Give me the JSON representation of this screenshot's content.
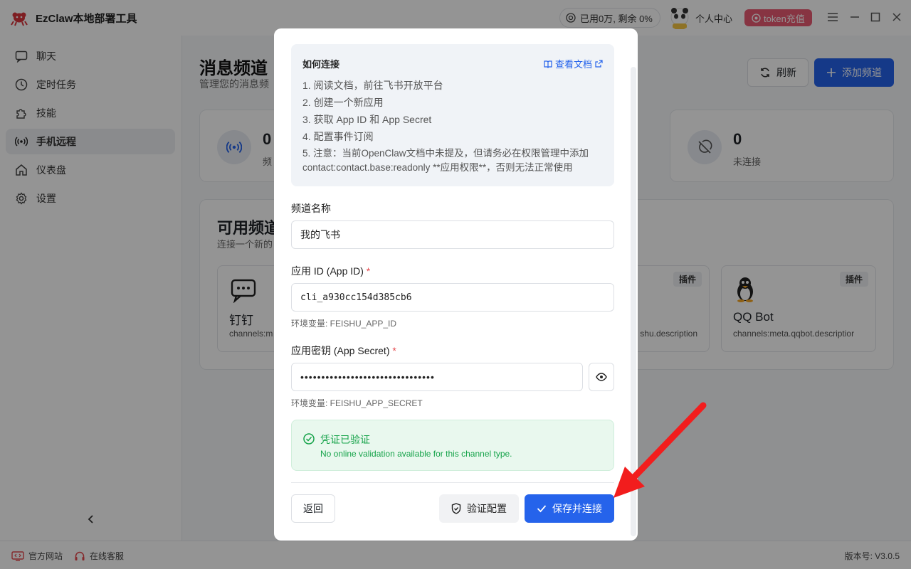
{
  "app": {
    "title": "EzClaw本地部署工具",
    "usage": "已用0万, 剩余 0%",
    "user_center": "个人中心",
    "token_button": "token充值"
  },
  "sidebar": {
    "items": [
      {
        "label": "聊天",
        "icon": "chat-icon"
      },
      {
        "label": "定时任务",
        "icon": "clock-icon"
      },
      {
        "label": "技能",
        "icon": "puzzle-icon"
      },
      {
        "label": "手机远程",
        "icon": "broadcast-icon",
        "active": true
      },
      {
        "label": "仪表盘",
        "icon": "home-icon"
      },
      {
        "label": "设置",
        "icon": "gear-icon"
      }
    ]
  },
  "main": {
    "title": "消息频道",
    "subtitle": "管理您的消息频",
    "refresh_label": "刷新",
    "add_label": "添加频道",
    "stats": [
      {
        "value": "0",
        "label": "频"
      },
      {
        "value": "0",
        "label": "未连接"
      }
    ],
    "available_title": "可用频道",
    "available_subtitle": "连接一个新的",
    "channels": [
      {
        "name": "钉钉",
        "desc": "channels:m",
        "tag": ""
      },
      {
        "name": "",
        "desc": "shu.description",
        "tag": "插件"
      },
      {
        "name": "QQ Bot",
        "desc": "channels:meta.qqbot.descriptior",
        "tag": "插件"
      }
    ]
  },
  "statusbar": {
    "website": "官方网站",
    "support": "在线客服",
    "version": "版本号: V3.0.5"
  },
  "modal": {
    "help": {
      "title": "如何连接",
      "doc_link": "查看文档",
      "steps": [
        "1. 阅读文档，前往飞书开放平台",
        "2. 创建一个新应用",
        "3. 获取 App ID 和 App Secret",
        "4. 配置事件订阅",
        "5. 注意：当前OpenClaw文档中未提及，但请务必在权限管理中添加",
        "contact:contact.base:readonly **应用权限**，否则无法正常使用"
      ]
    },
    "channel_name_label": "频道名称",
    "channel_name_value": "我的飞书",
    "app_id_label": "应用 ID (App ID)",
    "app_id_value": "cli_a930cc154d385cb6",
    "app_id_env": "环境变量: FEISHU_APP_ID",
    "app_secret_label": "应用密钥 (App Secret)",
    "app_secret_value": "••••••••••••••••••••••••••••••••",
    "app_secret_env": "环境变量: FEISHU_APP_SECRET",
    "success_title": "凭证已验证",
    "success_desc": "No online validation available for this channel type.",
    "back_label": "返回",
    "verify_label": "验证配置",
    "save_label": "保存并连接"
  },
  "colors": {
    "primary": "#2563eb",
    "success": "#16a34a",
    "token": "#e85a73",
    "annotation_arrow": "#f21d1d"
  }
}
